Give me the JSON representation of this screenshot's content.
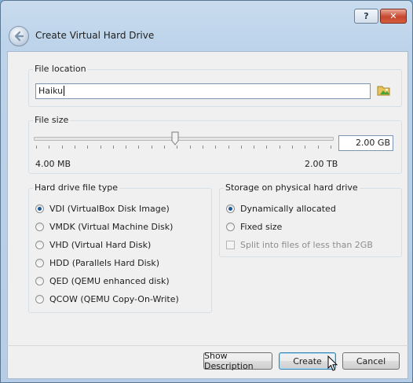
{
  "window": {
    "title": "Create Virtual Hard Drive",
    "help_button": "?",
    "close_button": "✕"
  },
  "file_location": {
    "label": "File location",
    "value": "Haiku"
  },
  "file_size": {
    "label": "File size",
    "value": "2.00 GB",
    "min_label": "4.00 MB",
    "max_label": "2.00 TB",
    "slider_fraction": 0.473
  },
  "file_type": {
    "label": "Hard drive file type",
    "options": [
      {
        "label": "VDI (VirtualBox Disk Image)",
        "selected": true
      },
      {
        "label": "VMDK (Virtual Machine Disk)",
        "selected": false
      },
      {
        "label": "VHD (Virtual Hard Disk)",
        "selected": false
      },
      {
        "label": "HDD (Parallels Hard Disk)",
        "selected": false
      },
      {
        "label": "QED (QEMU enhanced disk)",
        "selected": false
      },
      {
        "label": "QCOW (QEMU Copy-On-Write)",
        "selected": false
      }
    ]
  },
  "storage": {
    "label": "Storage on physical hard drive",
    "options": [
      {
        "label": "Dynamically allocated",
        "selected": true
      },
      {
        "label": "Fixed size",
        "selected": false
      }
    ],
    "split_label": "Split into files of less than 2GB",
    "split_checked": false,
    "split_enabled": false
  },
  "buttons": {
    "show_description": "Show Description",
    "create": "Create",
    "cancel": "Cancel"
  },
  "icons": {
    "back": "back-arrow-icon",
    "folder": "folder-icon",
    "help": "help-icon",
    "close": "close-icon",
    "cursor": "mouse-cursor-icon"
  }
}
